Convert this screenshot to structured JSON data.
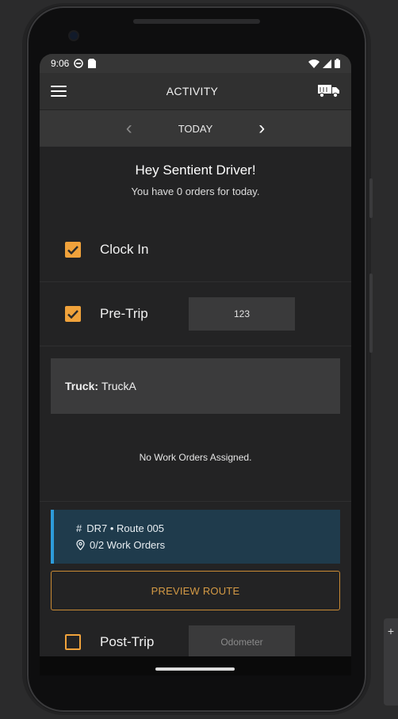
{
  "status": {
    "time": "9:06"
  },
  "appbar": {
    "title": "ACTIVITY"
  },
  "datebar": {
    "label": "TODAY"
  },
  "greeting": {
    "title": "Hey Sentient Driver!",
    "subtitle": "You have 0 orders for today."
  },
  "clock_in": {
    "label": "Clock In",
    "checked": true
  },
  "pre_trip": {
    "label": "Pre-Trip",
    "checked": true,
    "value": "123"
  },
  "truck": {
    "label": "Truck:",
    "value": "TruckA"
  },
  "work_orders": {
    "empty_text": "No Work Orders Assigned."
  },
  "route": {
    "line1": "DR7 • Route 005",
    "line2": "0/2 Work Orders"
  },
  "preview_button": {
    "label": "PREVIEW ROUTE"
  },
  "post_trip": {
    "label": "Post-Trip",
    "checked": false,
    "placeholder": "Odometer"
  },
  "colors": {
    "accent": "#f0a23b",
    "route_bg": "#1f3b4c",
    "route_bar": "#2d9cdb"
  }
}
